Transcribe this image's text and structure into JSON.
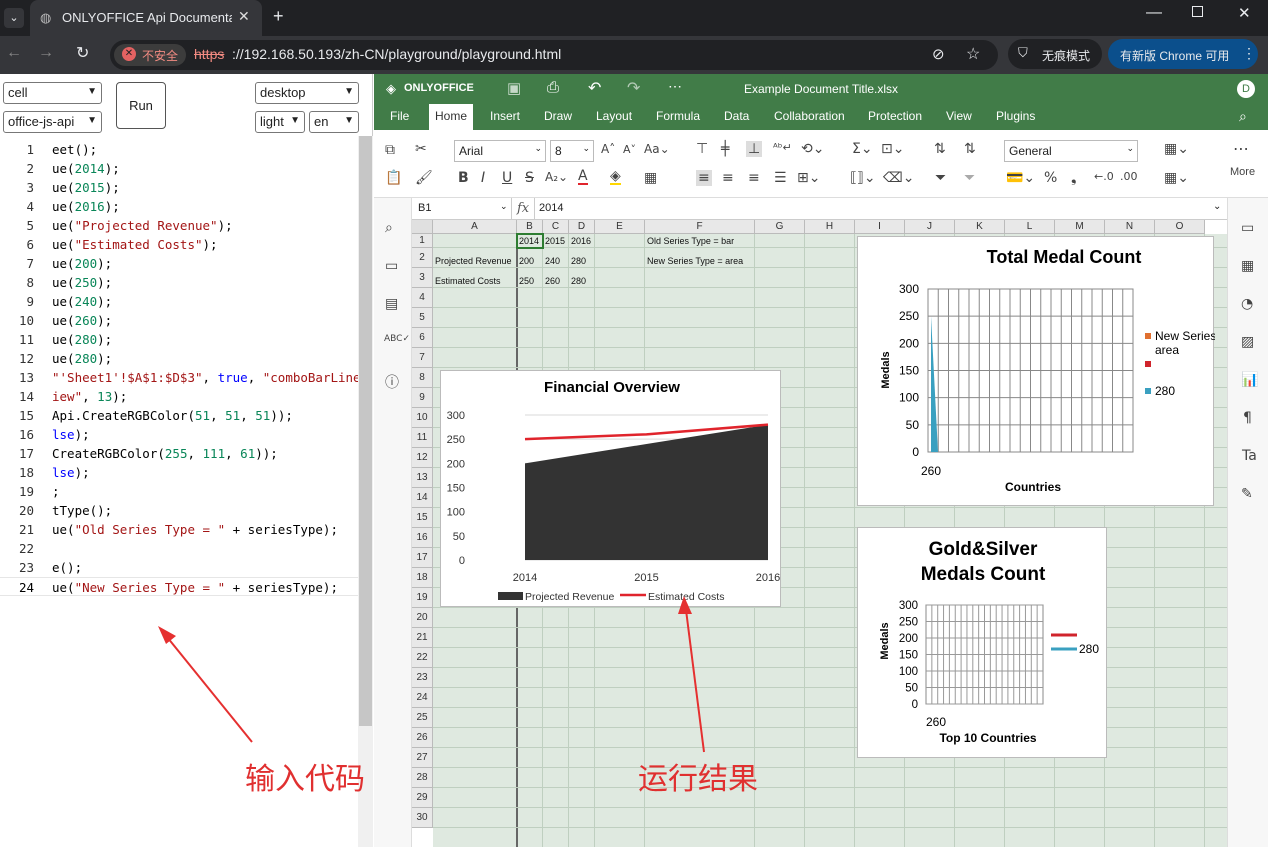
{
  "browser": {
    "tab_title": "ONLYOFFICE Api Documenta",
    "security_label": "不安全",
    "url_scheme": "https",
    "url_rest": "://192.168.50.193/zh-CN/playground/playground.html",
    "incognito_label": "无痕模式",
    "update_label": "有新版 Chrome 可用"
  },
  "playground": {
    "editor_type": "cell",
    "api_type": "office-js-api",
    "run_label": "Run",
    "platform": "desktop",
    "theme": "light",
    "lang": "en",
    "code_lines": [
      {
        "n": "1",
        "pre": "",
        "parts": [
          [
            "",
            "eet();"
          ]
        ]
      },
      {
        "n": "2",
        "pre": "",
        "parts": [
          [
            "",
            "ue("
          ],
          [
            "nm",
            "2014"
          ],
          [
            "",
            ");"
          ]
        ]
      },
      {
        "n": "3",
        "pre": "",
        "parts": [
          [
            "",
            "ue("
          ],
          [
            "nm",
            "2015"
          ],
          [
            "",
            ");"
          ]
        ]
      },
      {
        "n": "4",
        "pre": "",
        "parts": [
          [
            "",
            "ue("
          ],
          [
            "nm",
            "2016"
          ],
          [
            "",
            ");"
          ]
        ]
      },
      {
        "n": "5",
        "pre": "",
        "parts": [
          [
            "",
            "ue("
          ],
          [
            "st",
            "\"Projected Revenue\""
          ],
          [
            "",
            ");"
          ]
        ]
      },
      {
        "n": "6",
        "pre": "",
        "parts": [
          [
            "",
            "ue("
          ],
          [
            "st",
            "\"Estimated Costs\""
          ],
          [
            "",
            ");"
          ]
        ]
      },
      {
        "n": "7",
        "pre": "",
        "parts": [
          [
            "",
            "ue("
          ],
          [
            "nm",
            "200"
          ],
          [
            "",
            ");"
          ]
        ]
      },
      {
        "n": "8",
        "pre": "",
        "parts": [
          [
            "",
            "ue("
          ],
          [
            "nm",
            "250"
          ],
          [
            "",
            ");"
          ]
        ]
      },
      {
        "n": "9",
        "pre": "",
        "parts": [
          [
            "",
            "ue("
          ],
          [
            "nm",
            "240"
          ],
          [
            "",
            ");"
          ]
        ]
      },
      {
        "n": "10",
        "pre": "",
        "parts": [
          [
            "",
            "ue("
          ],
          [
            "nm",
            "260"
          ],
          [
            "",
            ");"
          ]
        ]
      },
      {
        "n": "11",
        "pre": "",
        "parts": [
          [
            "",
            "ue("
          ],
          [
            "nm",
            "280"
          ],
          [
            "",
            ");"
          ]
        ]
      },
      {
        "n": "12",
        "pre": "",
        "parts": [
          [
            "",
            "ue("
          ],
          [
            "nm",
            "280"
          ],
          [
            "",
            ");"
          ]
        ]
      },
      {
        "n": "13",
        "pre": "",
        "parts": [
          [
            "st",
            "\"'Sheet1'!$A$1:$D$3\""
          ],
          [
            "",
            ", "
          ],
          [
            "kw",
            "true"
          ],
          [
            "",
            ", "
          ],
          [
            "st",
            "\"comboBarLine\""
          ]
        ]
      },
      {
        "n": "14",
        "pre": "",
        "parts": [
          [
            "st",
            "iew\""
          ],
          [
            "",
            ", "
          ],
          [
            "nm",
            "13"
          ],
          [
            "",
            ");"
          ]
        ]
      },
      {
        "n": "15",
        "pre": "",
        "parts": [
          [
            "",
            "Api.CreateRGBColor("
          ],
          [
            "nm",
            "51"
          ],
          [
            "",
            ", "
          ],
          [
            "nm",
            "51"
          ],
          [
            "",
            ", "
          ],
          [
            "nm",
            "51"
          ],
          [
            "",
            "));"
          ]
        ]
      },
      {
        "n": "16",
        "pre": "",
        "parts": [
          [
            "kw",
            "lse"
          ],
          [
            "",
            ");"
          ]
        ]
      },
      {
        "n": "17",
        "pre": "",
        "parts": [
          [
            "",
            "CreateRGBColor("
          ],
          [
            "nm",
            "255"
          ],
          [
            "",
            ", "
          ],
          [
            "nm",
            "111"
          ],
          [
            "",
            ", "
          ],
          [
            "nm",
            "61"
          ],
          [
            "",
            "));"
          ]
        ]
      },
      {
        "n": "18",
        "pre": "",
        "parts": [
          [
            "kw",
            "lse"
          ],
          [
            "",
            ");"
          ]
        ]
      },
      {
        "n": "19",
        "pre": "",
        "parts": [
          [
            "",
            ";"
          ]
        ]
      },
      {
        "n": "20",
        "pre": "",
        "parts": [
          [
            "",
            "tType();"
          ]
        ]
      },
      {
        "n": "21",
        "pre": "",
        "parts": [
          [
            "",
            "ue("
          ],
          [
            "st",
            "\"Old Series Type = \""
          ],
          [
            "",
            " + seriesType);"
          ]
        ]
      },
      {
        "n": "22",
        "pre": "",
        "parts": []
      },
      {
        "n": "23",
        "pre": "",
        "parts": [
          [
            "",
            "e();"
          ]
        ]
      },
      {
        "n": "24",
        "pre": "",
        "parts": [
          [
            "",
            "ue("
          ],
          [
            "st",
            "\"New Series Type = \""
          ],
          [
            "",
            " + seriesType);"
          ]
        ]
      }
    ]
  },
  "editor": {
    "brand": "ONLYOFFICE",
    "doc_title": "Example Document Title.xlsx",
    "avatar": "D",
    "tabs": [
      "File",
      "Home",
      "Insert",
      "Draw",
      "Layout",
      "Formula",
      "Data",
      "Collaboration",
      "Protection",
      "View",
      "Plugins"
    ],
    "active_tab": "Home",
    "font_name": "Arial",
    "font_size": "8",
    "number_format": "General",
    "more_label": "More",
    "cell_ref": "B1",
    "formula": "2014"
  },
  "sheet": {
    "columns": [
      "A",
      "B",
      "C",
      "D",
      "E",
      "F",
      "G",
      "H",
      "I",
      "J",
      "K",
      "L",
      "M",
      "N",
      "O"
    ],
    "rows": [
      "1",
      "2",
      "3",
      "4",
      "5",
      "6",
      "7",
      "8",
      "9",
      "10",
      "11",
      "12",
      "13",
      "14",
      "15",
      "16",
      "17",
      "18",
      "19",
      "20",
      "21",
      "22",
      "23",
      "24",
      "25",
      "26",
      "27",
      "28",
      "29",
      "30"
    ],
    "cells": {
      "B1": "2014",
      "C1": "2015",
      "D1": "2016",
      "F1": "Old Series Type = bar",
      "A2": "Projected Revenue",
      "B2": "200",
      "C2": "240",
      "D2": "280",
      "F2": "New Series Type = area",
      "A3": "Estimated Costs",
      "B3": "250",
      "C3": "260",
      "D3": "280"
    }
  },
  "chart_data": [
    {
      "type": "area",
      "title": "Financial Overview",
      "categories": [
        "2014",
        "2015",
        "2016"
      ],
      "ylim": [
        0,
        300
      ],
      "yticks": [
        "300",
        "250",
        "200",
        "150",
        "100",
        "50",
        "0"
      ],
      "series": [
        {
          "name": "Projected Revenue",
          "values": [
            200,
            240,
            280
          ],
          "kind": "area",
          "color": "#333333"
        },
        {
          "name": "Estimated Costs",
          "values": [
            250,
            260,
            280
          ],
          "kind": "line",
          "color": "#e0242c"
        }
      ],
      "legend": "bottom"
    },
    {
      "type": "area",
      "title": "Total Medal Count",
      "xlabel": "Countries",
      "ylabel": "Medals",
      "categories": [
        "260"
      ],
      "ylim": [
        0,
        300
      ],
      "yticks": [
        "300",
        "250",
        "200",
        "150",
        "100",
        "50",
        "0"
      ],
      "legend": "right",
      "legend_items": [
        {
          "label": "New Series area",
          "color": "#e07030"
        },
        {
          "label": "",
          "color": "#d0242c"
        },
        {
          "label": "280",
          "color": "#3aa0c0"
        }
      ]
    },
    {
      "type": "line",
      "title_line1": "Gold&Silver",
      "title_line2": "Medals Count",
      "xlabel": "Top 10 Countries",
      "ylabel": "Medals",
      "categories": [
        "260"
      ],
      "ylim": [
        0,
        300
      ],
      "yticks": [
        "300",
        "250",
        "200",
        "150",
        "100",
        "50",
        "0"
      ],
      "legend": "right",
      "legend_items": [
        {
          "label": "",
          "color": "#d0242c"
        },
        {
          "label": "280",
          "color": "#3aa0c0"
        }
      ]
    }
  ],
  "annotations": {
    "input_code": "输入代码",
    "run_result": "运行结果"
  }
}
